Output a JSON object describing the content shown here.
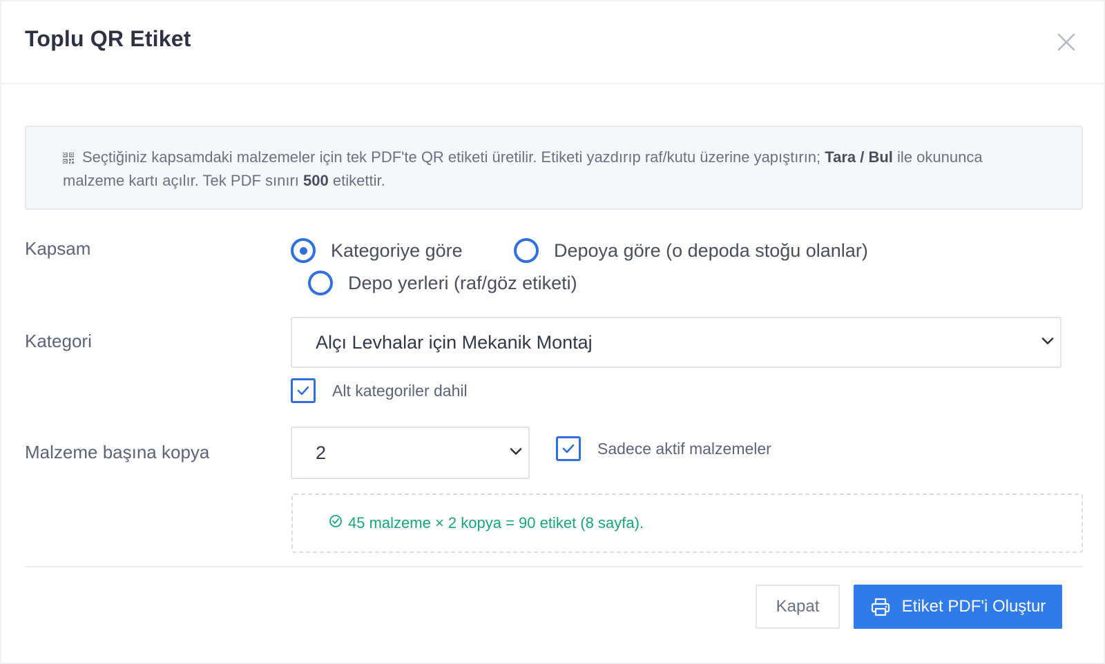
{
  "modal": {
    "title": "Toplu QR Etiket"
  },
  "info": {
    "text_part1": "Seçtiğiniz kapsamdaki malzemeler için tek PDF'te QR etiketi üretilir. Etiketi yazdırıp raf/kutu üzerine yapıştırın;",
    "bold_part": "Tara / Bul",
    "text_part2": "ile okununca malzeme kartı açılır. Tek PDF sınırı",
    "limit": "500",
    "text_part3": "etikettir."
  },
  "scope": {
    "label": "Kapsam",
    "options": [
      {
        "label": "Kategoriye göre",
        "checked": true
      },
      {
        "label": "Depoya göre (o depoda stoğu olanlar)",
        "checked": false
      },
      {
        "label": "Depo yerleri (raf/göz etiketi)",
        "checked": false
      }
    ]
  },
  "category": {
    "label": "Kategori",
    "selected": "Alçı Levhalar için Mekanik Montaj",
    "include_sub_label": "Alt kategoriler dahil",
    "include_sub_checked": true
  },
  "copies": {
    "label": "Malzeme başına kopya",
    "selected": "2",
    "only_active_label": "Sadece aktif malzemeler",
    "only_active_checked": true
  },
  "summary": {
    "text": "45 malzeme × 2 kopya = 90 etiket (8 sayfa)."
  },
  "footer": {
    "close_label": "Kapat",
    "generate_label": "Etiket PDF'i Oluştur"
  },
  "colors": {
    "primary": "#2f7bea",
    "success": "#17a673",
    "accent": "#2f6fe0"
  }
}
